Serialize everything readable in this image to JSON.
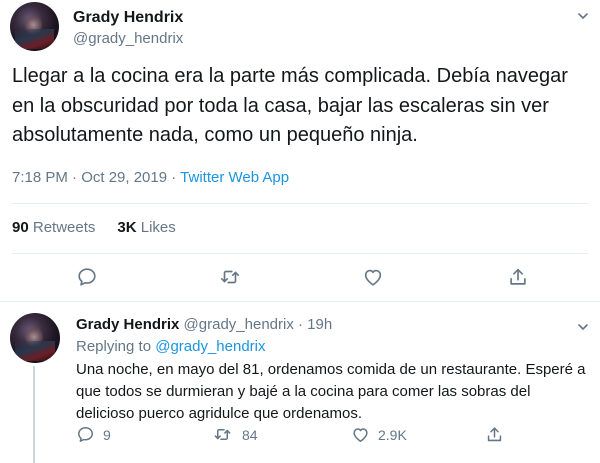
{
  "main_tweet": {
    "author_name": "Grady Hendrix",
    "author_handle": "@grady_hendrix",
    "text": "Llegar a la cocina era la parte más complicada. Debía navegar en la obscuridad por toda la casa, bajar las escaleras sin ver absolutamente nada, como un pequeño ninja.",
    "time": "7:18 PM · Oct 29, 2019 · ",
    "source": "Twitter Web App",
    "retweets_count": "90",
    "retweets_label": "Retweets",
    "likes_count": "3K",
    "likes_label": "Likes"
  },
  "reply_tweet": {
    "author_name": "Grady Hendrix",
    "author_handle": "@grady_hendrix · 19h",
    "replying_prefix": "Replying to ",
    "replying_to": "@grady_hendrix",
    "text": "Una noche, en mayo del 81, ordenamos comida de un restaurante. Esperé a que todos se durmieran y bajé a la cocina para comer las sobras del delicioso puerco agridulce que ordenamos.",
    "reply_count": "9",
    "retweet_count": "84",
    "like_count": "2.9K"
  },
  "icons": {
    "reply": "reply-icon",
    "retweet": "retweet-icon",
    "like": "heart-icon",
    "share": "share-icon",
    "more": "chevron-down-icon"
  },
  "colors": {
    "text_primary": "#14171a",
    "text_secondary": "#657786",
    "link": "#1b95e0",
    "divider": "#e6ecf0",
    "thread_line": "#ccd6dd"
  }
}
